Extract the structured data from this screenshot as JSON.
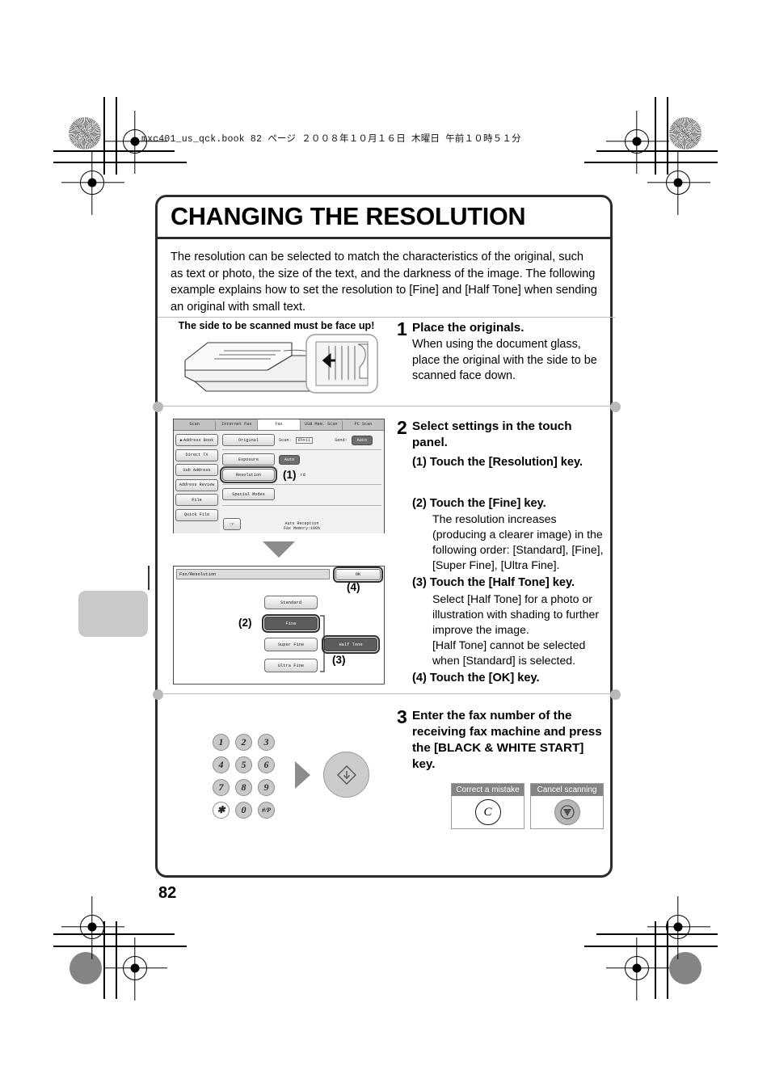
{
  "header": {
    "book_info": "mxc401_us_qck.book   82 ページ   ２００８年１０月１６日   木曜日   午前１０時５１分"
  },
  "page": {
    "title": "CHANGING THE RESOLUTION",
    "number": "82",
    "intro": "The resolution can be selected to match the characteristics of the original, such as text or photo, the size of the text, and the darkness of the image. The following example explains how to set the resolution to [Fine] and [Half Tone] when sending an original with small text."
  },
  "step1": {
    "num": "1",
    "heading": "Place the originals.",
    "body": "When using the document glass, place the original with the side to be scanned face down.",
    "illustration_caption": "The side to be scanned must be face up!"
  },
  "step2": {
    "num": "2",
    "heading": "Select settings in the touch panel.",
    "sub1": "(1) Touch the [Resolution] key.",
    "sub2": "(2) Touch the [Fine] key.",
    "sub2_body": "The resolution increases (producing a clearer image) in the following order: [Standard], [Fine], [Super Fine], [Ultra Fine].",
    "sub3": "(3) Touch the [Half Tone] key.",
    "sub3_body": "Select [Half Tone] for a photo or illustration with shading to further improve the image.",
    "sub3_body2": "[Half Tone] cannot be selected when [Standard] is selected.",
    "sub4": "(4) Touch the [OK] key."
  },
  "step3": {
    "num": "3",
    "heading": "Enter the fax number of the receiving fax machine and press the [BLACK & WHITE START] key."
  },
  "fax_panel": {
    "tabs": [
      {
        "label": "Scan",
        "active": false
      },
      {
        "label": "Internet Fax",
        "active": false
      },
      {
        "label": "Fax",
        "active": true
      },
      {
        "label": "USB Mem. Scan",
        "active": false
      },
      {
        "label": "PC Scan",
        "active": false
      }
    ],
    "side_buttons": [
      "Address Book",
      "Direct TX",
      "Sub Address",
      "Address Review",
      "File",
      "Quick File"
    ],
    "original_button": "Original",
    "scan_label": "Scan:",
    "scan_value": "8½x11",
    "send_label": "Send:",
    "send_value": "Auto",
    "exposure_button": "Exposure",
    "exposure_value": "Auto",
    "resolution_button": "Resolution",
    "resolution_value": "rd",
    "special_modes_button": "Special Modes",
    "status_reception": "Auto Reception",
    "status_memory": "Fax Memory:100%",
    "callout1": "(1)"
  },
  "resolution_dialog": {
    "title": "Fax/Resolution",
    "ok_button": "OK",
    "options": [
      "Standard",
      "Fine",
      "Super Fine",
      "Ultra Fine"
    ],
    "selected_option": "Fine",
    "half_tone_button": "Half Tone",
    "half_tone_selected": true,
    "callout2": "(2)",
    "callout3": "(3)",
    "callout4": "(4)"
  },
  "keypad": {
    "keys": [
      "1",
      "2",
      "3",
      "4",
      "5",
      "6",
      "7",
      "8",
      "9",
      "✱",
      "0",
      "#/P"
    ]
  },
  "hints": {
    "correct_mistake_label": "Correct a mistake",
    "correct_mistake_key": "C",
    "cancel_scanning_label": "Cancel scanning"
  },
  "colors": {
    "border": "#2b2b2b",
    "separator": "#b9b9b9",
    "tab_gray": "#c9c9c9",
    "panel_dark": "#6e6e6e"
  }
}
